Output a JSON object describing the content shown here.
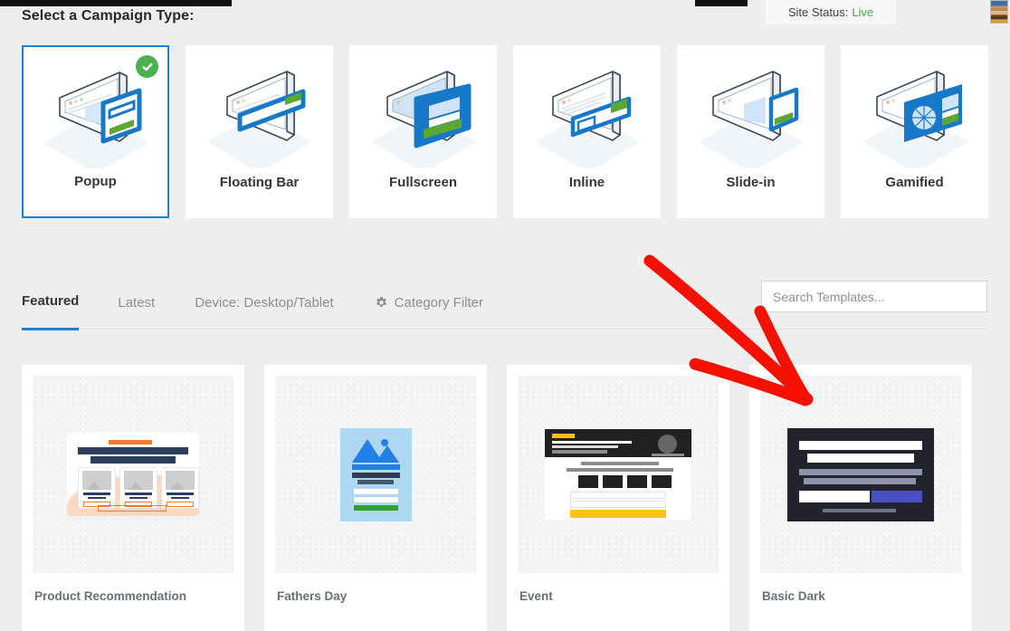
{
  "header": {
    "page_title": "Select a Campaign Type:",
    "site_status_label": "Site Status:",
    "site_status_value": "Live",
    "status_color": "#46a546"
  },
  "campaign_types": [
    {
      "label": "Popup",
      "icon": "popup-isometric-icon",
      "selected": true,
      "badge": "check-icon"
    },
    {
      "label": "Floating Bar",
      "icon": "floating-bar-isometric-icon",
      "selected": false
    },
    {
      "label": "Fullscreen",
      "icon": "fullscreen-isometric-icon",
      "selected": false
    },
    {
      "label": "Inline",
      "icon": "inline-isometric-icon",
      "selected": false
    },
    {
      "label": "Slide-in",
      "icon": "slide-in-isometric-icon",
      "selected": false
    },
    {
      "label": "Gamified",
      "icon": "gamified-isometric-icon",
      "selected": false
    }
  ],
  "filters": {
    "tabs": [
      {
        "label": "Featured",
        "active": true
      },
      {
        "label": "Latest",
        "active": false
      },
      {
        "label": "Device: Desktop/Tablet",
        "active": false
      },
      {
        "label": "Category Filter",
        "active": false,
        "icon": "gear-icon"
      }
    ],
    "active_underline_color": "#1c80d4"
  },
  "search": {
    "placeholder": "Search Templates...",
    "value": ""
  },
  "templates": [
    {
      "name": "Product Recommendation",
      "art": "product-recommendation-art"
    },
    {
      "name": "Fathers Day",
      "art": "fathers-day-art"
    },
    {
      "name": "Event",
      "art": "event-art"
    },
    {
      "name": "Basic Dark",
      "art": "basic-dark-art"
    }
  ],
  "annotation": {
    "type": "arrow",
    "color": "#f51000",
    "points_to": "Basic Dark"
  }
}
